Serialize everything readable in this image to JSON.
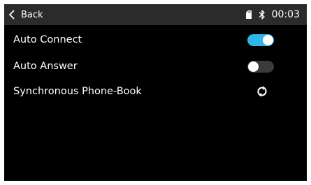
{
  "header": {
    "back_label": "Back",
    "back_icon": "chevron-left-icon",
    "status": {
      "sd_icon": "sd-card-icon",
      "bluetooth_icon": "bluetooth-icon",
      "time": "00:03"
    }
  },
  "settings": {
    "items": [
      {
        "label": "Auto Connect",
        "control": "toggle",
        "state": "on"
      },
      {
        "label": "Auto Answer",
        "control": "toggle",
        "state": "off"
      },
      {
        "label": "Synchronous Phone-Book",
        "control": "sync",
        "icon": "sync-icon"
      }
    ]
  },
  "colors": {
    "screen_bg": "#000000",
    "header_bg": "#2b2b2b",
    "text": "#ffffff",
    "toggle_on": "#2fb6e6",
    "toggle_off": "#3a3a3a",
    "knob": "#ffffff"
  }
}
